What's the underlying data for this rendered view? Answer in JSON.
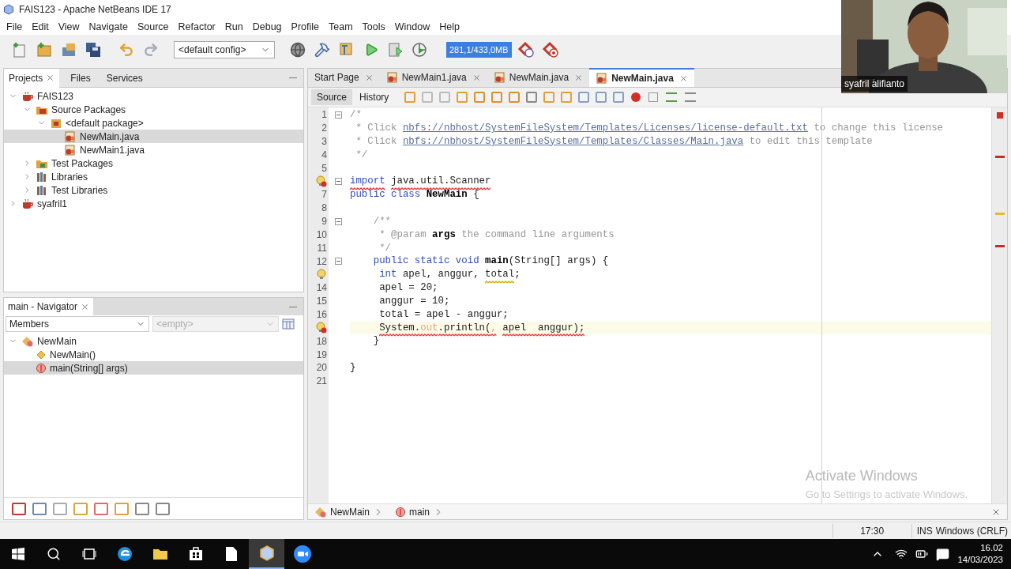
{
  "window": {
    "title": "FAIS123 - Apache NetBeans IDE 17"
  },
  "menu": [
    "File",
    "Edit",
    "View",
    "Navigate",
    "Source",
    "Refactor",
    "Run",
    "Debug",
    "Profile",
    "Team",
    "Tools",
    "Window",
    "Help"
  ],
  "toolbar": {
    "config": "<default config>",
    "memory": "281,1/433,0MB"
  },
  "projects_panel": {
    "tabs": [
      {
        "label": "Projects",
        "selected": true
      },
      {
        "label": "Files",
        "selected": false
      },
      {
        "label": "Services",
        "selected": false
      }
    ],
    "tree": [
      {
        "label": "FAIS123",
        "kind": "project",
        "expanded": true,
        "selected": false,
        "children": [
          {
            "label": "Source Packages",
            "kind": "sources",
            "expanded": true,
            "selected": false,
            "children": [
              {
                "label": "<default package>",
                "kind": "package",
                "expanded": true,
                "selected": false,
                "children": [
                  {
                    "label": "NewMain.java",
                    "kind": "file",
                    "selected": true
                  },
                  {
                    "label": "NewMain1.java",
                    "kind": "file",
                    "selected": false
                  }
                ]
              }
            ]
          },
          {
            "label": "Test Packages",
            "kind": "tests",
            "expanded": false,
            "selected": false
          },
          {
            "label": "Libraries",
            "kind": "library",
            "expanded": false,
            "selected": false
          },
          {
            "label": "Test Libraries",
            "kind": "library",
            "expanded": false,
            "selected": false
          }
        ]
      },
      {
        "label": "syafril1",
        "kind": "project",
        "expanded": false,
        "selected": false
      }
    ]
  },
  "navigator": {
    "title": "main - Navigator",
    "filter": "Members",
    "scope": {
      "value": "<empty>",
      "disabled": true
    },
    "tree": [
      {
        "label": "NewMain",
        "kind": "class",
        "expanded": true,
        "selected": false,
        "children": [
          {
            "label": "NewMain()",
            "kind": "constructor",
            "selected": false
          },
          {
            "label": "main(String[] args)",
            "kind": "method",
            "selected": true
          }
        ]
      }
    ]
  },
  "editor": {
    "tabs": [
      {
        "label": "Start Page",
        "kind": "page",
        "selected": false
      },
      {
        "label": "NewMain1.java",
        "kind": "file",
        "selected": false
      },
      {
        "label": "NewMain.java",
        "kind": "file",
        "selected": false
      },
      {
        "label": "NewMain.java",
        "kind": "file",
        "selected": true
      }
    ],
    "views": [
      {
        "label": "Source",
        "selected": true
      },
      {
        "label": "History",
        "selected": false
      }
    ],
    "lines": [
      {
        "kind": "plain",
        "number": "1",
        "fold": true,
        "current": false,
        "tokens": [
          {
            "t": "/*",
            "kind": "comment",
            "wavy": false
          }
        ]
      },
      {
        "kind": "plain",
        "number": "2",
        "fold": false,
        "current": false,
        "tokens": [
          {
            "t": " * Click ",
            "kind": "comment",
            "wavy": false
          },
          {
            "t": "nbfs://nbhost/SystemFileSystem/Templates/Licenses/license-default.txt",
            "kind": "link",
            "wavy": false
          },
          {
            "t": " to change this license",
            "kind": "comment",
            "wavy": false
          }
        ]
      },
      {
        "kind": "plain",
        "number": "3",
        "fold": false,
        "current": false,
        "tokens": [
          {
            "t": " * Click ",
            "kind": "comment",
            "wavy": false
          },
          {
            "t": "nbfs://nbhost/SystemFileSystem/Templates/Classes/Main.java",
            "kind": "link",
            "wavy": false
          },
          {
            "t": " to edit this template",
            "kind": "comment",
            "wavy": false
          }
        ]
      },
      {
        "kind": "plain",
        "number": "4",
        "fold": false,
        "current": false,
        "tokens": [
          {
            "t": " */",
            "kind": "comment",
            "wavy": false
          }
        ]
      },
      {
        "kind": "plain",
        "number": "5",
        "fold": false,
        "current": false
      },
      {
        "kind": "error-hint",
        "fold": true,
        "current": false,
        "tokens": [
          {
            "t": "import",
            "kind": "keyword",
            "wavy": true
          },
          {
            "t": " java.util.Scanner",
            "kind": "text",
            "wavy": true
          }
        ]
      },
      {
        "kind": "plain",
        "number": "7",
        "fold": false,
        "current": false,
        "tokens": [
          {
            "t": "public class ",
            "kind": "keyword",
            "wavy": false
          },
          {
            "t": "NewMain",
            "kind": "name",
            "wavy": false
          },
          {
            "t": " {",
            "kind": "text",
            "wavy": false
          }
        ]
      },
      {
        "kind": "plain",
        "number": "8",
        "fold": false,
        "current": false
      },
      {
        "kind": "plain",
        "number": "9",
        "fold": true,
        "current": false,
        "tokens": [
          {
            "t": "    /**",
            "kind": "comment",
            "wavy": false
          }
        ]
      },
      {
        "kind": "plain",
        "number": "10",
        "fold": false,
        "current": false,
        "tokens": [
          {
            "t": "     * @param ",
            "kind": "comment",
            "wavy": false
          },
          {
            "t": "args",
            "kind": "name",
            "wavy": false
          },
          {
            "t": " the command line arguments",
            "kind": "comment",
            "wavy": false
          }
        ]
      },
      {
        "kind": "plain",
        "number": "11",
        "fold": false,
        "current": false,
        "tokens": [
          {
            "t": "     */",
            "kind": "comment",
            "wavy": false
          }
        ]
      },
      {
        "kind": "plain",
        "number": "12",
        "fold": true,
        "current": false,
        "tokens": [
          {
            "t": "    public static void ",
            "kind": "keyword",
            "wavy": false
          },
          {
            "t": "main",
            "kind": "name",
            "wavy": false
          },
          {
            "t": "(String[] args) {",
            "kind": "text",
            "wavy": false
          }
        ]
      },
      {
        "kind": "hint",
        "fold": false,
        "current": false,
        "tokens": [
          {
            "t": "     int",
            "kind": "keyword",
            "wavy": false
          },
          {
            "t": " apel, anggur, ",
            "kind": "text",
            "wavy": false
          },
          {
            "t": "total",
            "kind": "text",
            "wavy": true
          },
          {
            "t": ";",
            "kind": "text",
            "wavy": false
          }
        ]
      },
      {
        "kind": "plain",
        "number": "14",
        "fold": false,
        "current": false,
        "tokens": [
          {
            "t": "     apel = 20;",
            "kind": "text",
            "wavy": false
          }
        ]
      },
      {
        "kind": "plain",
        "number": "15",
        "fold": false,
        "current": false,
        "tokens": [
          {
            "t": "     anggur = 10;",
            "kind": "text",
            "wavy": false
          }
        ]
      },
      {
        "kind": "plain",
        "number": "16",
        "fold": false,
        "current": false,
        "tokens": [
          {
            "t": "     total = apel - anggur;",
            "kind": "text",
            "wavy": false
          }
        ]
      },
      {
        "kind": "error-hint",
        "fold": false,
        "current": true,
        "tokens": [
          {
            "t": "     System.",
            "kind": "text",
            "wavy": true
          },
          {
            "t": "out",
            "kind": "field",
            "wavy": true
          },
          {
            "t": ".println(",
            "kind": "text",
            "wavy": true
          },
          {
            "t": ",",
            "kind": "field",
            "wavy": true
          },
          {
            "t": " apel  anggur);",
            "kind": "text",
            "wavy": true
          }
        ]
      },
      {
        "kind": "plain",
        "number": "18",
        "fold": false,
        "current": false,
        "tokens": [
          {
            "t": "    }",
            "kind": "text",
            "wavy": false
          }
        ]
      },
      {
        "kind": "plain",
        "number": "19",
        "fold": false,
        "current": false
      },
      {
        "kind": "plain",
        "number": "20",
        "fold": false,
        "current": false,
        "tokens": [
          {
            "t": "}",
            "kind": "text",
            "wavy": false
          }
        ]
      },
      {
        "kind": "plain",
        "number": "21",
        "fold": false,
        "current": false
      }
    ],
    "breadcrumbs": [
      {
        "label": "NewMain",
        "kind": "class"
      },
      {
        "label": "main",
        "kind": "method"
      }
    ]
  },
  "status_bar": {
    "position": "17:30",
    "mode": "INS",
    "line_endings": "Windows (CRLF)"
  },
  "activation_notice": {
    "title": "Activate Windows",
    "text": "Go to Settings to activate Windows."
  },
  "webcam": {
    "name": "syafril alifianto"
  },
  "taskbar": {
    "time": "16.02",
    "date": "14/03/2023"
  }
}
